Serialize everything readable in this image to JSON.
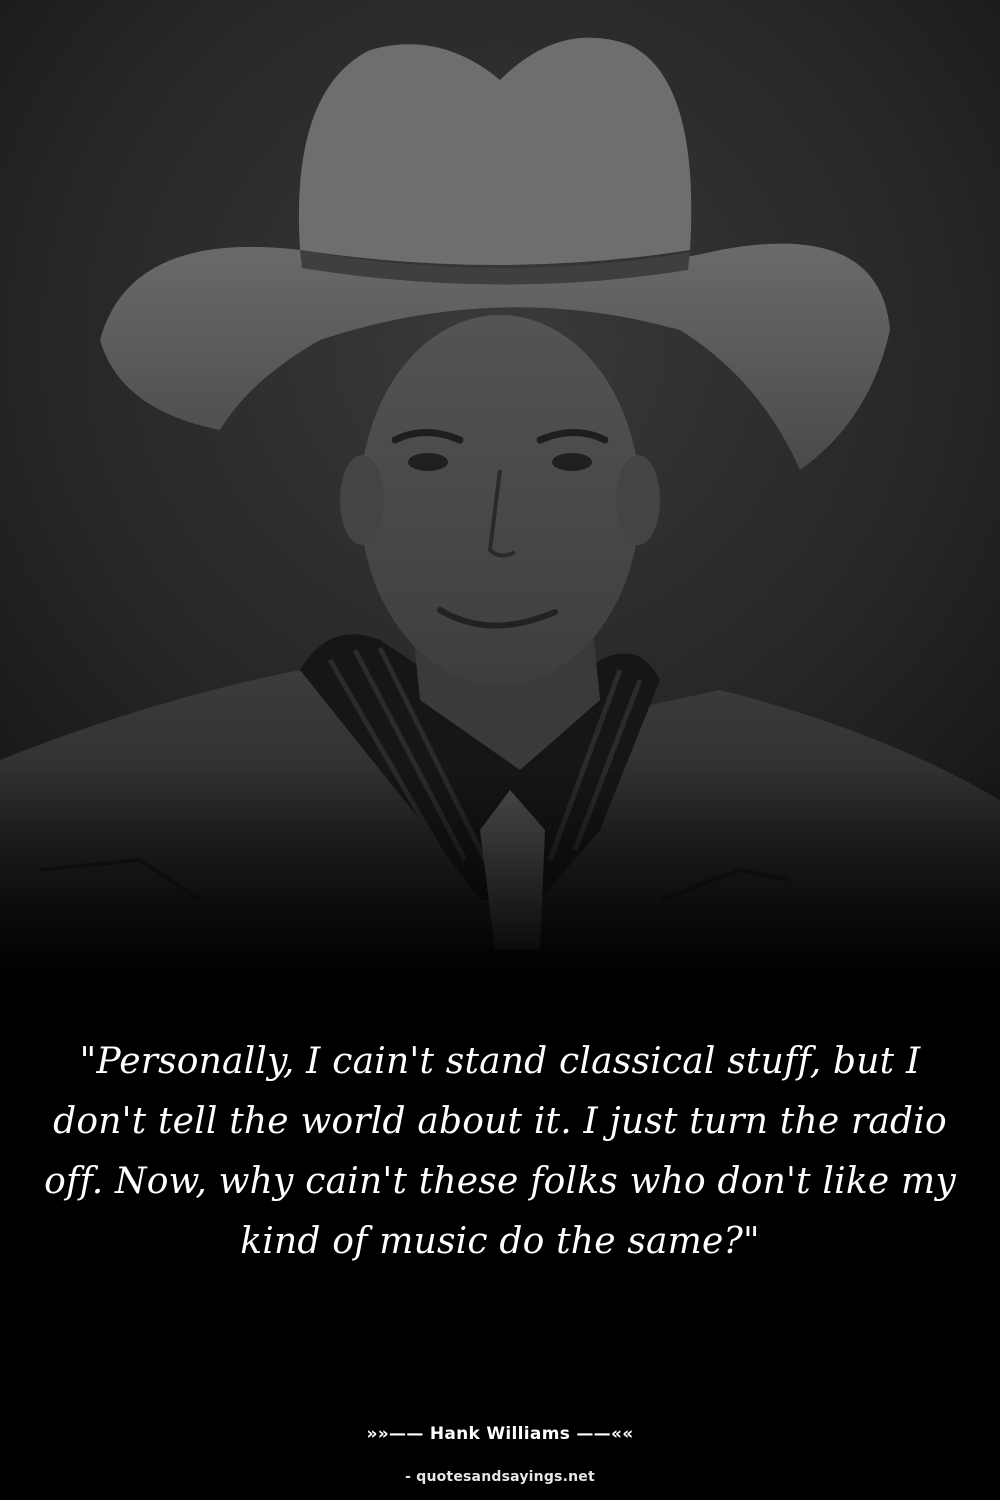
{
  "quote": {
    "text": "\"Personally, I cain't stand classical stuff, but I don't tell the world about it. I just turn the radio off. Now, why cain't these folks who don't like my kind of music do the same?\""
  },
  "attribution": {
    "author_line": "»»—— Hank Williams ——««"
  },
  "footer": {
    "source": "- quotesandsayings.net"
  },
  "colors": {
    "background": "#000000",
    "quote_text": "#ffffff",
    "photo_tint": "#2a2a2a"
  }
}
